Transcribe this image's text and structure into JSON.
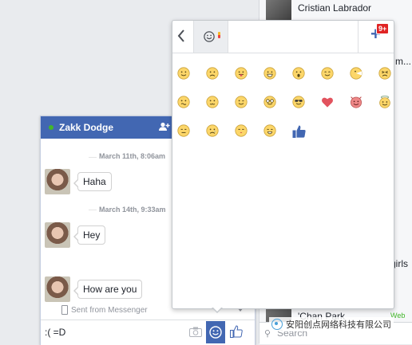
{
  "sidebar": {
    "contacts": [
      {
        "name": "Cristian Labrador"
      },
      {
        "name": "'Chan Park"
      }
    ],
    "clipped_text_1": "m...",
    "clipped_text_2": "girls",
    "web_label": "Web",
    "search_placeholder": "Search",
    "watermark": "安阳创点网络科技有限公司"
  },
  "chat": {
    "contact_name": "Zakk Dodge",
    "messages": [
      {
        "timestamp": "March 11th, 8:06am",
        "text": "Haha"
      },
      {
        "timestamp": "March 14th, 9:33am",
        "text": "Hey"
      },
      {
        "timestamp": "",
        "text": "How are you"
      }
    ],
    "sent_from": "Sent from Messenger",
    "composer_value": ":( =D"
  },
  "emoji_panel": {
    "badge": "9+",
    "emojis": [
      {
        "icon": "smile-emoji"
      },
      {
        "icon": "frown-emoji"
      },
      {
        "icon": "tongue-emoji"
      },
      {
        "icon": "grin-emoji"
      },
      {
        "icon": "gasp-emoji"
      },
      {
        "icon": "smile-2-emoji"
      },
      {
        "icon": "pacman-emoji"
      },
      {
        "icon": "squint-emoji"
      },
      {
        "icon": "confused-emoji"
      },
      {
        "icon": "curly-lips-emoji"
      },
      {
        "icon": "wink-emoji"
      },
      {
        "icon": "glasses-emoji"
      },
      {
        "icon": "sunglasses-emoji"
      },
      {
        "icon": "heart-emoji"
      },
      {
        "icon": "devil-emoji"
      },
      {
        "icon": "angel-emoji"
      },
      {
        "icon": "unsure-emoji"
      },
      {
        "icon": "cry-emoji"
      },
      {
        "icon": "kiss-emoji"
      },
      {
        "icon": "kiki-emoji"
      },
      {
        "icon": "thumbs-up-emoji"
      }
    ]
  },
  "colors": {
    "brand_blue": "#4267b2",
    "online_green": "#42b72a",
    "badge_red": "#e02424",
    "emoji_yellow": "#fcd669"
  }
}
